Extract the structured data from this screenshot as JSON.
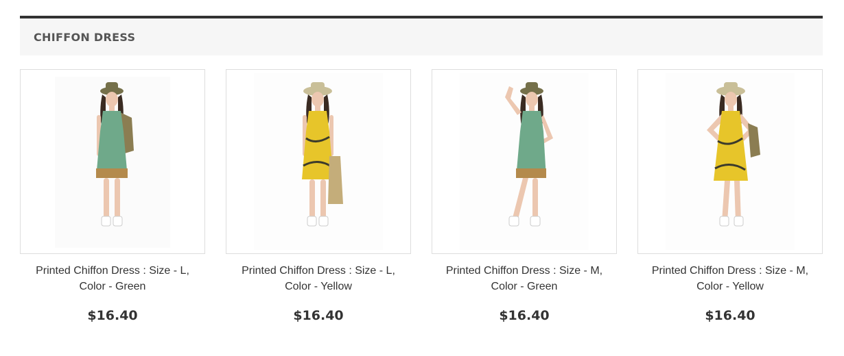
{
  "block": {
    "title": "CHIFFON DRESS"
  },
  "products": [
    {
      "name": "Printed Chiffon Dress : Size - L, Color - Green",
      "price": "$16.40",
      "image": "model-green-dress-photo",
      "dress_color": "#6fa98a"
    },
    {
      "name": "Printed Chiffon Dress : Size - L, Color - Yellow",
      "price": "$16.40",
      "image": "model-yellow-dress-photo",
      "dress_color": "#e7c52a"
    },
    {
      "name": "Printed Chiffon Dress : Size - M, Color - Green",
      "price": "$16.40",
      "image": "model-green-dress-photo",
      "dress_color": "#6fa98a"
    },
    {
      "name": "Printed Chiffon Dress : Size - M, Color - Yellow",
      "price": "$16.40",
      "image": "model-yellow-dress-photo",
      "dress_color": "#e7c52a"
    }
  ],
  "colors": {
    "header_border": "#333333",
    "header_bg": "#f6f6f6",
    "text": "#333333",
    "image_border": "#dddddd"
  }
}
